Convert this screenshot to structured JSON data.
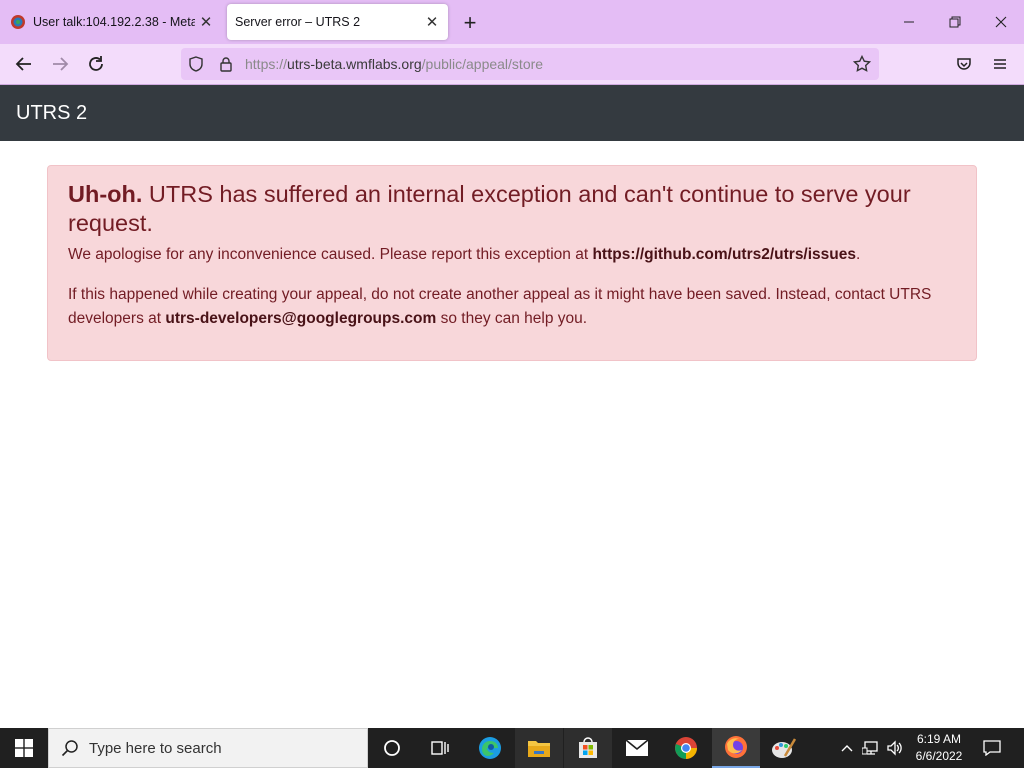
{
  "browser": {
    "tabs": [
      {
        "title": "User talk:104.192.2.38 - Meta",
        "active": false
      },
      {
        "title": "Server error – UTRS 2",
        "active": true
      }
    ],
    "address": {
      "scheme": "https://",
      "host": "utrs-beta.wmflabs.org",
      "path": "/public/appeal/store"
    },
    "theme_colors": {
      "tabstrip": "#e4bdf5",
      "toolbar": "#f3dcfb",
      "urlbar": "#e9c6f7"
    }
  },
  "page": {
    "brand": "UTRS 2",
    "alert": {
      "heading_strong": "Uh-oh.",
      "heading_rest": "UTRS has suffered an internal exception and can't continue to serve your request.",
      "p1_text": "We apologise for any inconvenience caused. Please report this exception at",
      "p1_link": "https://github.com/utrs2/utrs/issues",
      "p1_end": ".",
      "p2_text": "If this happened while creating your appeal, do not create another appeal as it might have been saved. Instead, contact UTRS developers at",
      "p2_email": "utrs-developers@googlegroups.com",
      "p2_end": "so they can help you."
    },
    "colors": {
      "navbar": "#343a40",
      "alert_bg": "#f8d7da",
      "alert_text": "#721c24"
    }
  },
  "taskbar": {
    "search_placeholder": "Type here to search",
    "pinned": [
      "cortana-icon",
      "task-view-icon",
      "edge-icon",
      "file-explorer-icon",
      "store-icon",
      "mail-icon",
      "chrome-icon",
      "firefox-icon",
      "paint-icon"
    ],
    "clock": {
      "time": "6:19 AM",
      "date": "6/6/2022"
    }
  }
}
